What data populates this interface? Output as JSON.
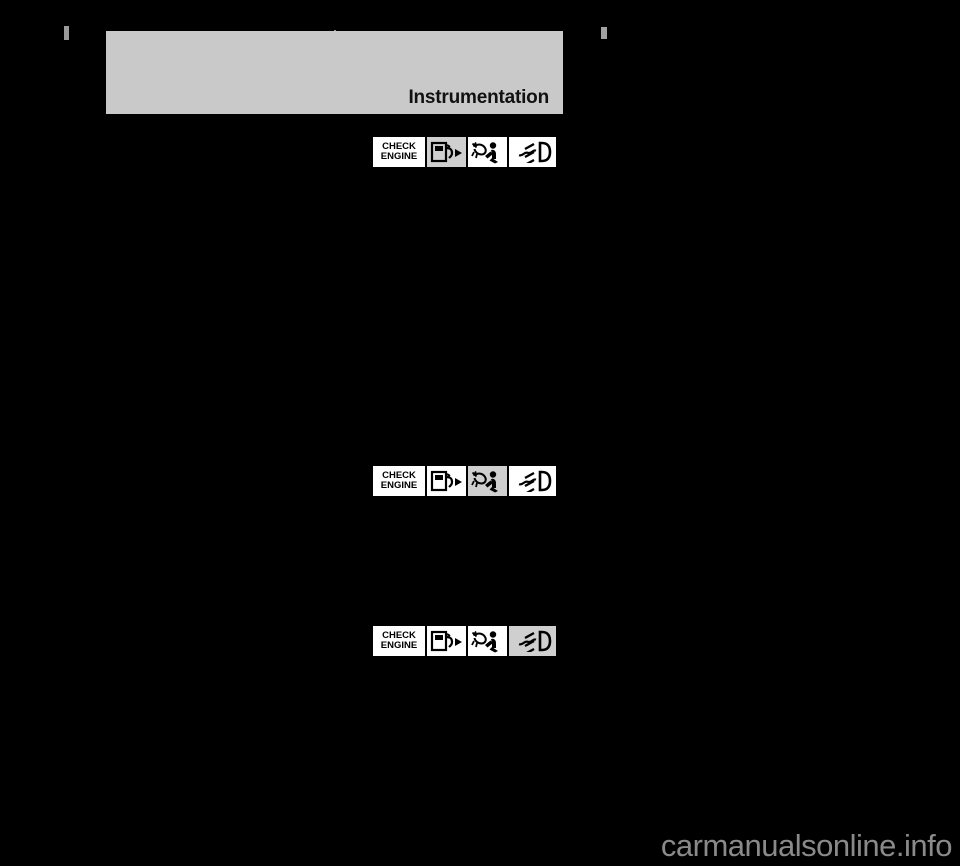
{
  "page": {
    "background_color": "#000000",
    "header": {
      "title": "Instrumentation",
      "band_color": "#c9c9c9"
    },
    "watermark": {
      "text": "carmanualsonline.info",
      "color": "#8a8a8a"
    },
    "registration_marks": [
      {
        "name": "left-crop-mark"
      },
      {
        "name": "center-crop-mark"
      },
      {
        "name": "right-crop-mark"
      }
    ]
  },
  "clusters": [
    {
      "name": "instrument-cluster-fuel-highlighted",
      "lit_index": 1,
      "cells": [
        {
          "type": "text",
          "label_line1": "CHECK",
          "label_line2": "ENGINE",
          "icon": "check-engine-text",
          "lit": false
        },
        {
          "type": "icon",
          "icon": "fuel-pump-icon",
          "lit": true
        },
        {
          "type": "icon",
          "icon": "airbag-srs-icon",
          "lit": false
        },
        {
          "type": "icon",
          "icon": "fog-lamp-icon",
          "lit": false
        }
      ]
    },
    {
      "name": "instrument-cluster-airbag-highlighted",
      "lit_index": 2,
      "cells": [
        {
          "type": "text",
          "label_line1": "CHECK",
          "label_line2": "ENGINE",
          "icon": "check-engine-text",
          "lit": false
        },
        {
          "type": "icon",
          "icon": "fuel-pump-icon",
          "lit": false
        },
        {
          "type": "icon",
          "icon": "airbag-srs-icon",
          "lit": true
        },
        {
          "type": "icon",
          "icon": "fog-lamp-icon",
          "lit": false
        }
      ]
    },
    {
      "name": "instrument-cluster-foglamp-highlighted",
      "lit_index": 3,
      "cells": [
        {
          "type": "text",
          "label_line1": "CHECK",
          "label_line2": "ENGINE",
          "icon": "check-engine-text",
          "lit": false
        },
        {
          "type": "icon",
          "icon": "fuel-pump-icon",
          "lit": false
        },
        {
          "type": "icon",
          "icon": "airbag-srs-icon",
          "lit": false
        },
        {
          "type": "icon",
          "icon": "fog-lamp-icon",
          "lit": true
        }
      ]
    }
  ]
}
